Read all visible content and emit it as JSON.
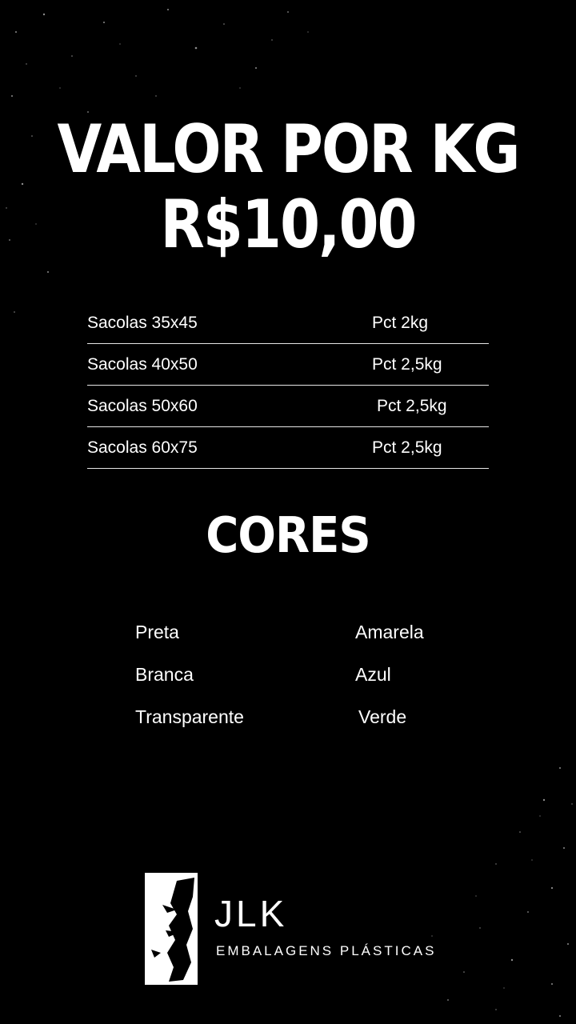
{
  "header": {
    "title_line1": "VALOR POR KG",
    "title_line2": "R$10,00"
  },
  "sizes": [
    {
      "name": "Sacolas 35x45",
      "pack": "Pct 2kg"
    },
    {
      "name": "Sacolas 40x50",
      "pack": "Pct 2,5kg"
    },
    {
      "name": "Sacolas 50x60",
      "pack": "Pct 2,5kg"
    },
    {
      "name": "Sacolas 60x75",
      "pack": "Pct 2,5kg"
    }
  ],
  "colors": {
    "title": "CORES",
    "left": [
      "Preta",
      "Branca",
      "Transparente"
    ],
    "right": [
      "Amarela",
      "Azul",
      "Verde"
    ]
  },
  "brand": {
    "name": "JLK",
    "tagline": "EMBALAGENS PLÁSTICAS",
    "logo_icon": "panther-head-icon"
  },
  "theme": {
    "background": "#000000",
    "text": "#ffffff"
  }
}
